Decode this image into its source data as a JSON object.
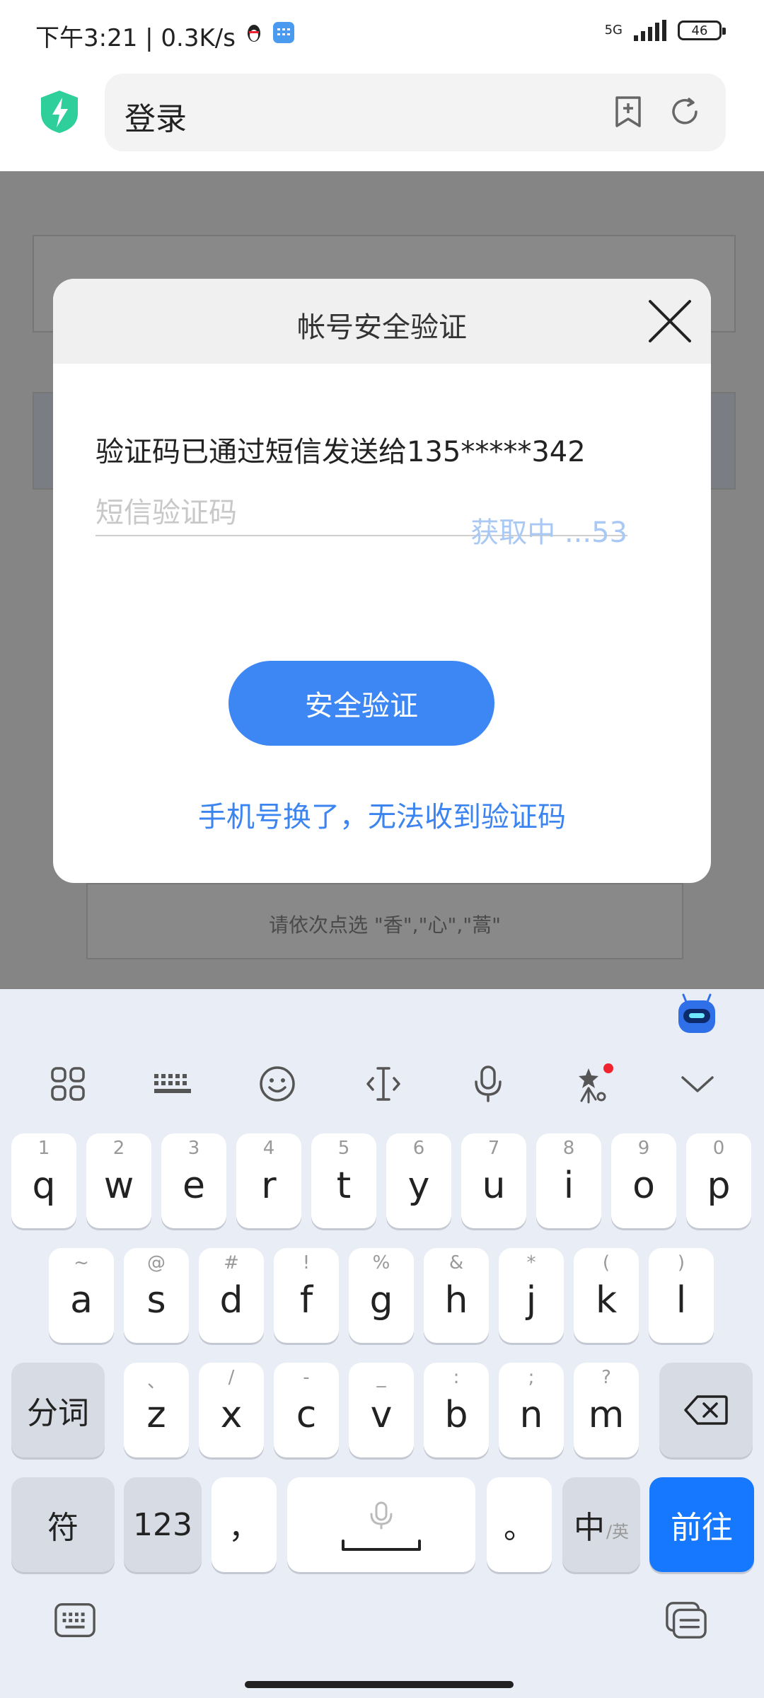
{
  "status_bar": {
    "time_speed": "下午3:21 | 0.3K/s",
    "network": "5G",
    "battery": "46"
  },
  "address_bar": {
    "title": "登录"
  },
  "background_page": {
    "captcha_hint": "请依次点选 \"香\",\"心\",\"蒿\""
  },
  "dialog": {
    "title": "帐号安全验证",
    "info": "验证码已通过短信发送给135*****342",
    "sms_placeholder": "短信验证码",
    "countdown": "获取中 ...53",
    "verify_button": "安全验证",
    "change_phone_link": "手机号换了，无法收到验证码"
  },
  "keyboard": {
    "row1": [
      {
        "hint": "1",
        "key": "q"
      },
      {
        "hint": "2",
        "key": "w"
      },
      {
        "hint": "3",
        "key": "e"
      },
      {
        "hint": "4",
        "key": "r"
      },
      {
        "hint": "5",
        "key": "t"
      },
      {
        "hint": "6",
        "key": "y"
      },
      {
        "hint": "7",
        "key": "u"
      },
      {
        "hint": "8",
        "key": "i"
      },
      {
        "hint": "9",
        "key": "o"
      },
      {
        "hint": "0",
        "key": "p"
      }
    ],
    "row2": [
      {
        "hint": "~",
        "key": "a"
      },
      {
        "hint": "@",
        "key": "s"
      },
      {
        "hint": "#",
        "key": "d"
      },
      {
        "hint": "!",
        "key": "f"
      },
      {
        "hint": "%",
        "key": "g"
      },
      {
        "hint": "&",
        "key": "h"
      },
      {
        "hint": "*",
        "key": "j"
      },
      {
        "hint": "(",
        "key": "k"
      },
      {
        "hint": ")",
        "key": "l"
      }
    ],
    "row3": [
      {
        "hint": "、",
        "key": "z"
      },
      {
        "hint": "/",
        "key": "x"
      },
      {
        "hint": "-",
        "key": "c"
      },
      {
        "hint": "_",
        "key": "v"
      },
      {
        "hint": ":",
        "key": "b"
      },
      {
        "hint": ";",
        "key": "n"
      },
      {
        "hint": "?",
        "key": "m"
      }
    ],
    "segment_key": "分词",
    "symbol_key": "符",
    "number_key": "123",
    "comma_key": "，",
    "period_key": "。",
    "lang_key_main": "中",
    "lang_key_sub": "/英",
    "go_key": "前往"
  }
}
